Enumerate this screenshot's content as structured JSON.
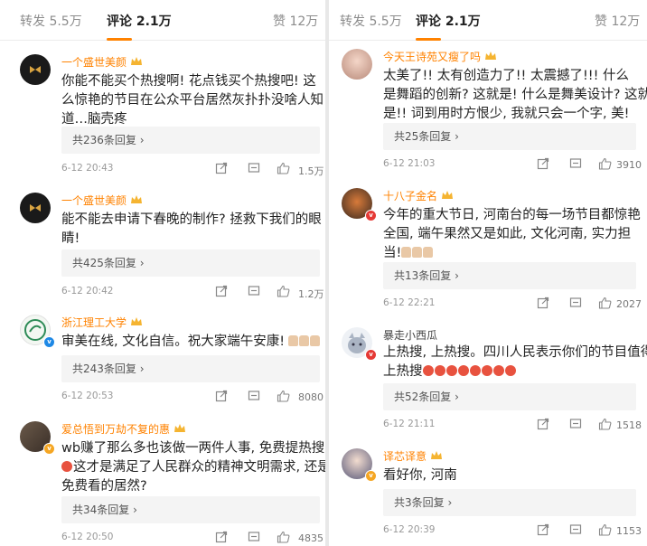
{
  "left": {
    "tabs": {
      "repost": "转发 5.5万",
      "comments": "评论 2.1万",
      "likes": "赞 12万"
    },
    "comments": [
      {
        "user": "一个盛世美颜",
        "lines": [
          "你能不能买个热搜啊! 花点钱买个热搜吧! 这",
          "么惊艳的节目在公众平台居然灰扑扑没啥人知",
          "道…脑壳疼"
        ],
        "replies": "共236条回复",
        "time": "6-12 20:43",
        "likes": "1.5万"
      },
      {
        "user": "一个盛世美颜",
        "lines": [
          "能不能去申请下春晚的制作? 拯救下我们的眼",
          "睛!"
        ],
        "replies": "共425条回复",
        "time": "6-12 20:42",
        "likes": "1.2万"
      },
      {
        "user": "浙江理工大学",
        "lines": [
          "审美在线, 文化自信。祝大家端午安康!"
        ],
        "replies": "共243条回复",
        "time": "6-12 20:53",
        "likes": "8080"
      },
      {
        "user": "爱总悟到万劫不复的惠",
        "lines": [
          "wb赚了那么多也该做一两件人事, 免费提热搜",
          "这才是满足了人民群众的精神文明需求, 还是",
          "免费看的居然?"
        ],
        "replies": "共34条回复",
        "time": "6-12 20:50",
        "likes": "4835"
      }
    ]
  },
  "right": {
    "tabs": {
      "repost": "转发 5.5万",
      "comments": "评论 2.1万",
      "likes": "赞 12万"
    },
    "comments": [
      {
        "user": "今天王诗苑又瘦了吗",
        "lines": [
          "太美了!! 太有创造力了!! 太震撼了!!! 什么",
          "是舞蹈的创新? 这就是! 什么是舞美设计? 这就",
          "是!! 词到用时方恨少, 我就只会一个字, 美!"
        ],
        "replies": "共25条回复",
        "time": "6-12 21:03",
        "likes": "3910"
      },
      {
        "user": "十八子金名",
        "lines": [
          "今年的重大节日, 河南台的每一场节目都惊艳",
          "全国, 端午果然又是如此, 文化河南, 实力担",
          "当!"
        ],
        "replies": "共13条回复",
        "time": "6-12 22:21",
        "likes": "2027"
      },
      {
        "user": "暴走小西瓜",
        "lines": [
          "上热搜, 上热搜。四川人民表示你们的节目值得",
          "上热搜"
        ],
        "replies": "共52条回复",
        "time": "6-12 21:11",
        "likes": "1518"
      },
      {
        "user": "译芯译意",
        "lines": [
          "看好你, 河南"
        ],
        "replies": "共3条回复",
        "time": "6-12 20:39",
        "likes": "1153"
      }
    ]
  },
  "colors": {
    "accent": "#ff8200",
    "reply_bg": "#f4f4f4"
  },
  "icons": [
    "crown-icon",
    "share-icon",
    "comment-icon",
    "like-icon",
    "chevron-right-icon",
    "verified-badge-icon"
  ]
}
